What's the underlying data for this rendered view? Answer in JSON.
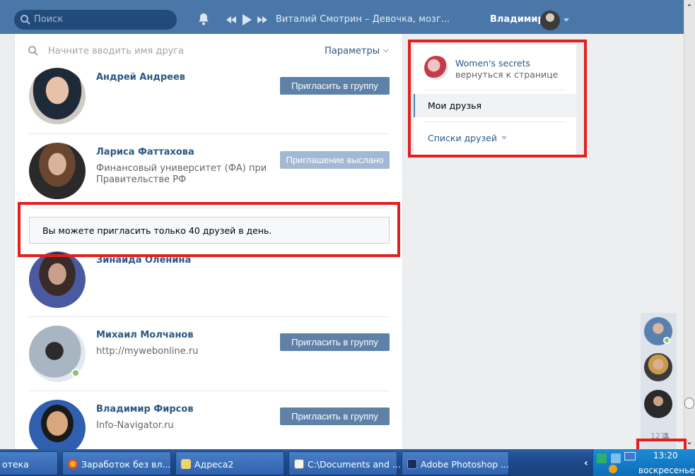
{
  "header": {
    "search_placeholder": "Поиск",
    "now_playing": "Виталий Смотрин – Девочка, мозг...",
    "user_name": "Владимир"
  },
  "friends_panel": {
    "search_placeholder": "Начните вводить имя друга",
    "params_label": "Параметры",
    "notice": "Вы можете пригласить только 40 друзей в день.",
    "rows": [
      {
        "name": "Андрей Андреев",
        "sub1": "",
        "sub2": "",
        "button": "Пригласить в группу",
        "button_state": "invite"
      },
      {
        "name": "Лариса Фаттахова",
        "sub1": "Финансовый университет (ФА) при",
        "sub2": "Правительстве РФ",
        "button": "Приглашение выслано",
        "button_state": "sent"
      },
      {
        "name": "Зинаида Оленина",
        "sub1": "",
        "sub2": "",
        "button": "",
        "button_state": "none"
      },
      {
        "name": "Михаил Молчанов",
        "sub1": "http://mywebonline.ru",
        "sub2": "",
        "button": "Пригласить в группу",
        "button_state": "invite"
      },
      {
        "name": "Владимир Фирсов",
        "sub1": "Info-Navigator.ru",
        "sub2": "",
        "button": "Пригласить в группу",
        "button_state": "invite"
      }
    ]
  },
  "side_menu": {
    "group_name": "Women's secrets",
    "back_label": "вернуться к странице",
    "active_item": "Мои друзья",
    "lists_label": "Списки друзей"
  },
  "chat": {
    "online_count": "127"
  },
  "taskbar": {
    "items": [
      "отека",
      "Заработок без вл...",
      "Адреса2",
      "C:\\Documents and ...",
      "Adobe Photoshop ..."
    ],
    "time": "13:20",
    "day": "воскресенье"
  },
  "colors": {
    "header": "#4a76a8",
    "link": "#2a5885",
    "button": "#5e81a8",
    "button_sent": "#a3b8d2",
    "highlight": "#e31e1e",
    "online": "#8ac176"
  }
}
